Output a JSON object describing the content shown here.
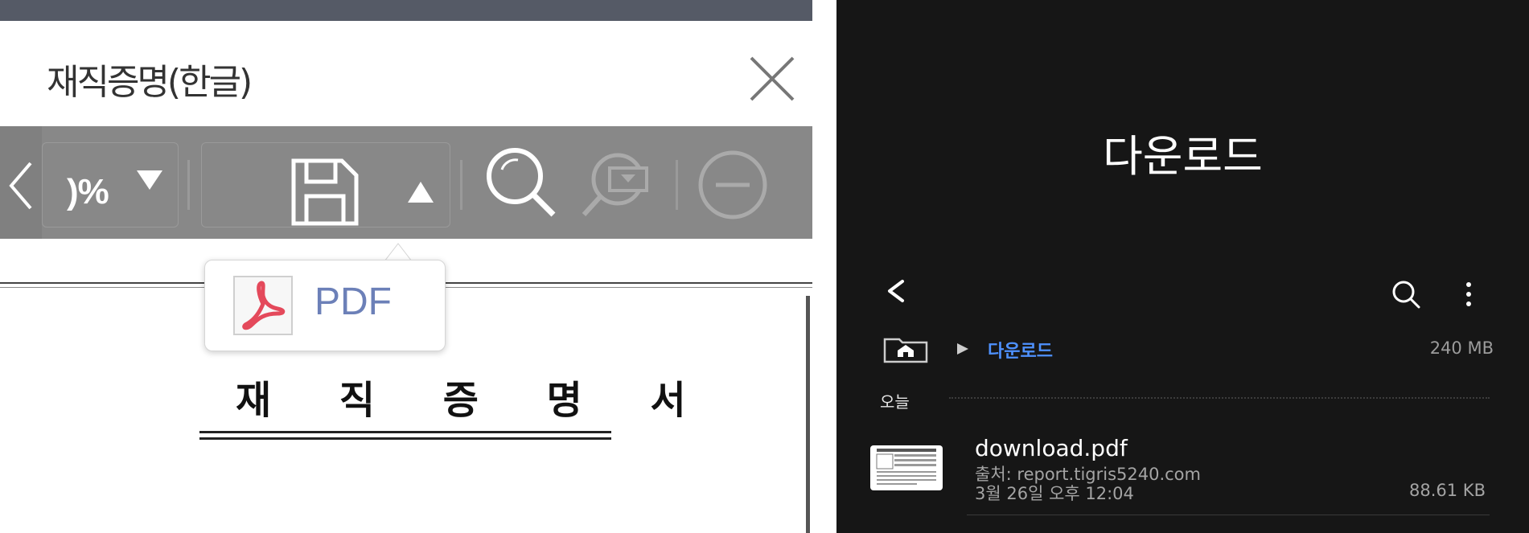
{
  "viewer": {
    "title": "재직증명(한글)",
    "toolbar": {
      "zoom_value": ")%",
      "save_icon": "floppy-disk-icon",
      "search_icon": "magnifier-icon",
      "find_icon": "find-in-document-icon",
      "zoom_out_icon": "minus-circle-icon"
    },
    "export_menu": {
      "items": [
        {
          "label": "PDF",
          "icon": "pdf-icon"
        }
      ]
    },
    "document": {
      "heading": "재 직 증 명 서"
    },
    "colors": {
      "toolbar_bg": "#888888",
      "topbar_bg": "#555a66",
      "pdf_text": "#6c80b8",
      "pdf_icon": "#e4495b"
    }
  },
  "phone": {
    "title": "다운로드",
    "breadcrumb": {
      "current": "다운로드"
    },
    "storage_used": "240 MB",
    "sections": [
      {
        "label": "오늘",
        "files": [
          {
            "name": "download.pdf",
            "source": "출처: report.tigris5240.com",
            "date": "3월 26일 오후 12:04",
            "size": "88.61 KB"
          }
        ]
      }
    ],
    "colors": {
      "background": "#161616",
      "accent": "#4e91ff"
    }
  }
}
